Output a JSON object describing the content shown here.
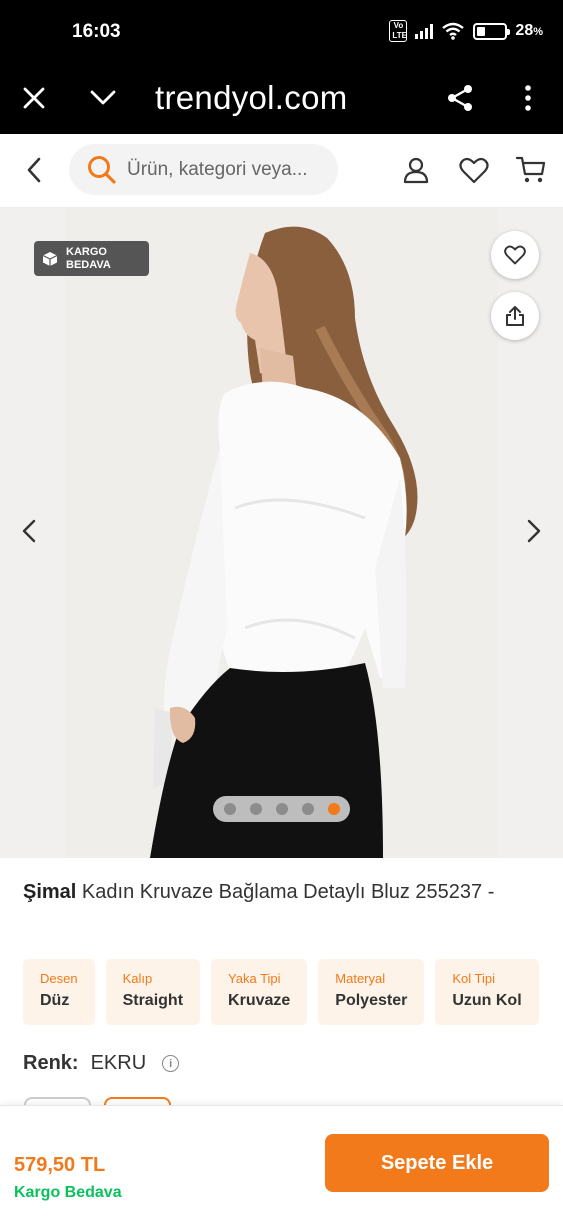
{
  "status_bar": {
    "time": "16:03",
    "volte": "Vo LTE",
    "battery_percent": "28",
    "battery_unit": "%"
  },
  "browser": {
    "url": "trendyol.com"
  },
  "header": {
    "search_placeholder": "Ürün, kategori veya..."
  },
  "gallery": {
    "badge_line1": "KARGO",
    "badge_line2": "BEDAVA",
    "image_count": 5,
    "active_index": 4,
    "image_description_icon": "model-in-white-blouse-photo"
  },
  "product": {
    "brand": "Şimal",
    "name": "Kadın Kruvaze Bağlama Detaylı Bluz 255237 -",
    "attributes": [
      {
        "label": "Desen",
        "value": "Düz"
      },
      {
        "label": "Kalıp",
        "value": "Straight"
      },
      {
        "label": "Yaka Tipi",
        "value": "Kruvaze"
      },
      {
        "label": "Materyal",
        "value": "Polyester"
      },
      {
        "label": "Kol Tipi",
        "value": "Uzun Kol"
      }
    ],
    "color_label": "Renk:",
    "color_value": "EKRU",
    "info_glyph": "i"
  },
  "footer": {
    "price": "579,50 TL",
    "shipping": "Kargo Bedava",
    "add_to_cart": "Sepete Ekle"
  },
  "colors": {
    "accent": "#f27a1a",
    "green": "#0bc15c",
    "attr_bg": "#fdf3e8"
  }
}
